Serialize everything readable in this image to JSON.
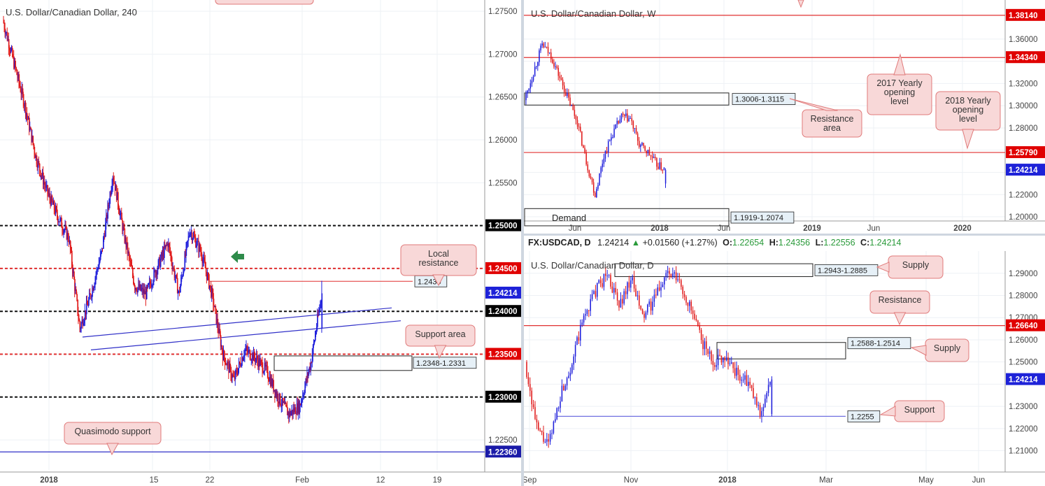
{
  "colors": {
    "up": "#1d1ddb",
    "down": "#e01818",
    "black": "#111111",
    "redline": "#e03030",
    "blueline": "#3030c8",
    "callout_bg": "#f8d8d8",
    "callout_border": "#e07a7a",
    "box_bg": "#e6f0f7",
    "grid": "#eef1f5"
  },
  "chart_data": [
    {
      "id": "h4",
      "type": "candlestick",
      "title": "U.S. Dollar/Canadian Dollar, 240",
      "ylim": [
        1.2215,
        1.2755
      ],
      "x_labels": [
        "2018",
        "15",
        "22",
        "Feb",
        "12",
        "19"
      ],
      "y_ticks": [
        "1.27500",
        "1.27000",
        "1.26500",
        "1.26000",
        "1.25500",
        "1.25000",
        "1.24500",
        "1.24214",
        "1.24000",
        "1.23500",
        "1.23000",
        "1.22500",
        "1.22360"
      ],
      "series": {
        "name": "USDCAD",
        "first_value": 1.274,
        "last_value": 1.2421
      },
      "levels": [
        {
          "value": 1.25,
          "label": "1.25000",
          "style": "black-dashed"
        },
        {
          "value": 1.245,
          "label": "1.24500",
          "style": "red-dashed"
        },
        {
          "value": 1.24,
          "label": "1.24000",
          "style": "black-dashed"
        },
        {
          "value": 1.235,
          "label": "1.23500",
          "style": "red-dashed"
        },
        {
          "value": 1.23,
          "label": "1.23000",
          "style": "black-dashed"
        },
        {
          "value": 1.2236,
          "label": "1.22360",
          "style": "blue-solid"
        },
        {
          "value": 1.24214,
          "label": "1.24214",
          "style": "current"
        }
      ],
      "annotations": [
        {
          "text": "1.2435",
          "kind": "box-label"
        },
        {
          "text": "1.2348-1.2331",
          "kind": "box-label"
        },
        {
          "text": "Local resistance",
          "kind": "callout"
        },
        {
          "text": "Support area",
          "kind": "callout"
        },
        {
          "text": "Quasimodo support",
          "kind": "callout"
        }
      ]
    },
    {
      "id": "weekly",
      "type": "candlestick",
      "title": "U.S. Dollar/Canadian Dollar, W",
      "ylim": [
        1.195,
        1.392
      ],
      "x_labels": [
        "Jun",
        "2018",
        "Jun",
        "2019",
        "Jun",
        "2020"
      ],
      "y_ticks": [
        "1.38140",
        "1.36000",
        "1.34340",
        "1.32000",
        "1.30000",
        "1.28000",
        "1.25790",
        "1.24214",
        "1.22000",
        "1.20000"
      ],
      "levels": [
        {
          "value": 1.3814,
          "label": "1.38140",
          "style": "red-solid"
        },
        {
          "value": 1.3434,
          "label": "1.34340",
          "style": "red-solid"
        },
        {
          "value": 1.2579,
          "label": "1.25790",
          "style": "red-solid"
        },
        {
          "value": 1.24214,
          "label": "1.24214",
          "style": "current"
        }
      ],
      "zones": [
        {
          "from": 1.3006,
          "to": 1.3115,
          "label": "1.3006-1.3115"
        },
        {
          "from": 1.1919,
          "to": 1.2074,
          "label": "1.1919-1.2074",
          "text": "Demand"
        }
      ],
      "annotations": [
        {
          "text": "2017 Yearly opening level",
          "kind": "callout"
        },
        {
          "text": "2018 Yearly opening level",
          "kind": "callout"
        },
        {
          "text": "Resistance area",
          "kind": "callout"
        }
      ]
    },
    {
      "id": "daily",
      "type": "candlestick",
      "title": "U.S. Dollar/Canadian Dollar, D",
      "ylim": [
        1.2045,
        1.2975
      ],
      "x_labels": [
        "Sep",
        "Nov",
        "2018",
        "Mar",
        "May",
        "Jun"
      ],
      "y_ticks": [
        "1.29000",
        "1.28000",
        "1.27000",
        "1.26640",
        "1.26000",
        "1.25000",
        "1.24214",
        "1.23000",
        "1.22000",
        "1.21000"
      ],
      "levels": [
        {
          "value": 1.2664,
          "label": "1.26640",
          "style": "red-solid"
        },
        {
          "value": 1.2255,
          "label": "1.2255",
          "style": "blue-solid"
        },
        {
          "value": 1.24214,
          "label": "1.24214",
          "style": "current"
        }
      ],
      "zones": [
        {
          "from": 1.2885,
          "to": 1.2943,
          "label": "1.2943-1.2885"
        },
        {
          "from": 1.2514,
          "to": 1.2588,
          "label": "1.2588-1.2514"
        }
      ],
      "annotations": [
        {
          "text": "Supply",
          "kind": "callout"
        },
        {
          "text": "Resistance",
          "kind": "callout"
        },
        {
          "text": "Supply",
          "kind": "callout"
        },
        {
          "text": "Support",
          "kind": "callout"
        }
      ]
    }
  ],
  "daily_header": {
    "symbol": "FX:USDCAD, D",
    "price": "1.24214",
    "change": "+0.01560 (+1.27%)",
    "o_label": "O:",
    "o": "1.22654",
    "h_label": "H:",
    "h": "1.24356",
    "l_label": "L:",
    "l": "1.22556",
    "c_label": "C:",
    "c": "1.24214"
  }
}
